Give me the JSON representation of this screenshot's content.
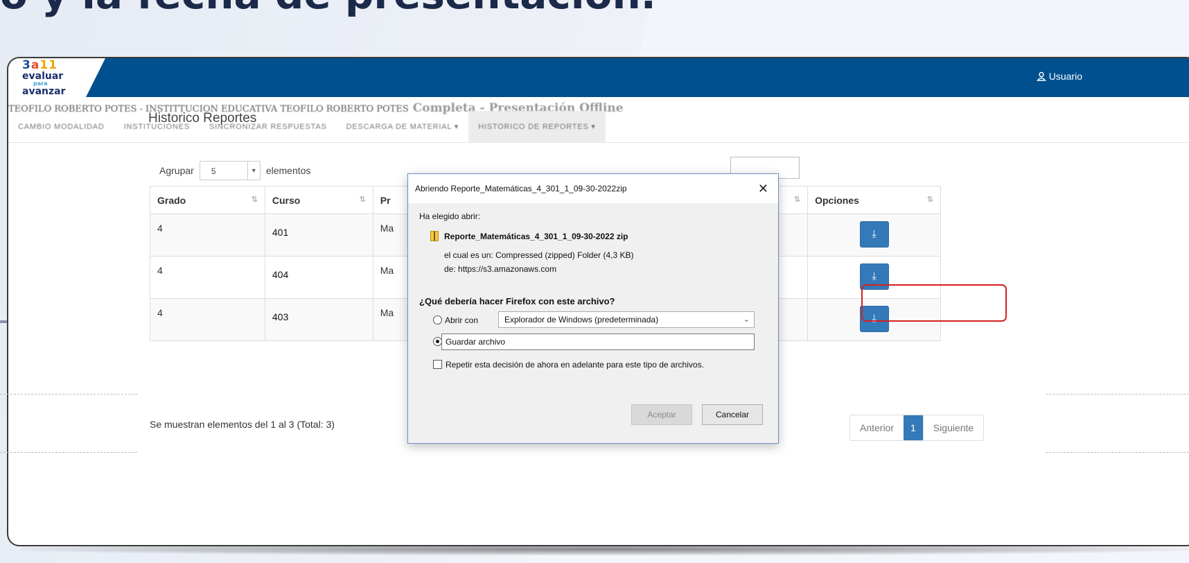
{
  "background": {
    "heading_fragment": "o y la fecha de presentación."
  },
  "app": {
    "logo": {
      "n3": "3",
      "a": "a",
      "n11": "11",
      "line1": "evaluar",
      "line2": "para",
      "line3": "avanzar"
    },
    "user_label": "Usuario",
    "institution": "TEOFILO ROBERTO POTES - INSTITTUCION EDUCATIVA TEOFILO ROBERTO POTES",
    "mode": "Completa - Presentación Offline",
    "nav": [
      {
        "label": "CAMBIO MODALIDAD"
      },
      {
        "label": "INSTITUCIONES"
      },
      {
        "label": "SINCRONIZAR RESPUESTAS"
      },
      {
        "label": "DESCARGA DE MATERIAL ▾"
      },
      {
        "label": "HISTORICO DE REPORTES ▾"
      }
    ]
  },
  "reports": {
    "title": "Historico Reportes",
    "group_label": "Agrupar",
    "group_value": "5",
    "group_suffix": "elementos",
    "columns": [
      "Grado",
      "Curso",
      "Pr",
      "Opciones"
    ],
    "rows": [
      {
        "grado": "4",
        "curso": "401",
        "prueba": "Ma"
      },
      {
        "grado": "4",
        "curso": "404",
        "prueba": "Ma"
      },
      {
        "grado": "4",
        "curso": "403",
        "prueba": "Ma"
      }
    ],
    "info": "Se muestran elementos del 1 al 3 (Total: 3)",
    "pager": {
      "prev": "Anterior",
      "current": "1",
      "next": "Siguiente"
    }
  },
  "dialog": {
    "title": "Abriendo Reporte_Matemáticas_4_301_1_09-30-2022zip",
    "chosen": "Ha elegido abrir:",
    "filename": "Reporte_Matemáticas_4_301_1_09-30-2022 zip",
    "type_label": "el cual es un:",
    "type_value": "Compressed (zipped) Folder (4,3 KB)",
    "from_label": "de:",
    "from_value": "https://s3.amazonaws.com",
    "question": "¿Qué debería hacer Firefox con este archivo?",
    "open_with_label": "Abrir con",
    "open_with_value": "Explorador de Windows (predeterminada)",
    "save_label": "Guardar archivo",
    "repeat_label": "Repetir esta decisión de ahora en adelante para este tipo de archivos.",
    "accept": "Aceptar",
    "cancel": "Cancelar"
  }
}
